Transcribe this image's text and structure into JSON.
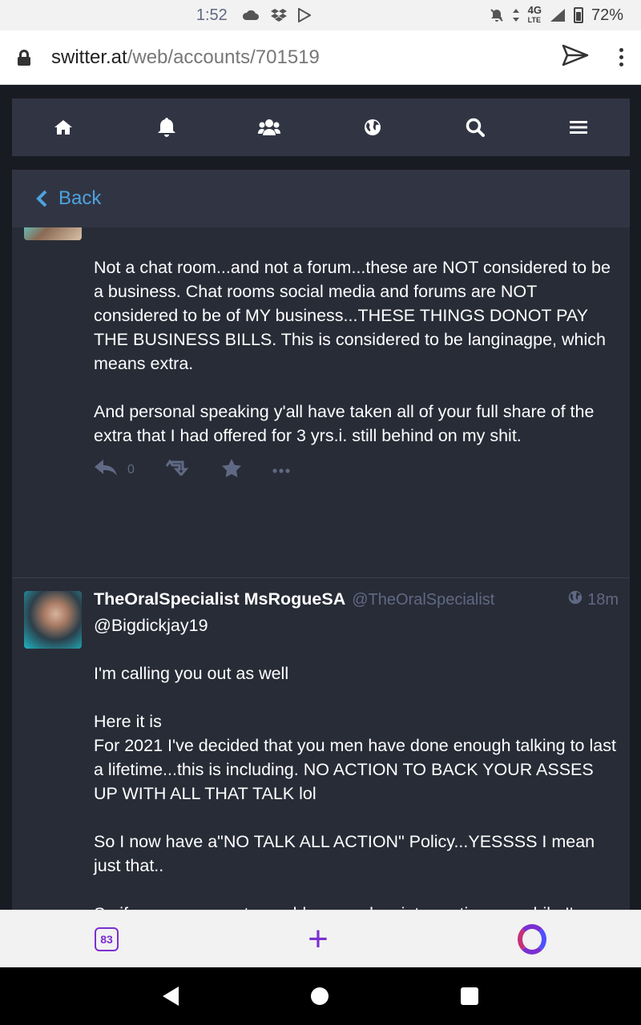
{
  "status_bar": {
    "time": "1:52",
    "network": "4G",
    "network_sub": "LTE",
    "battery": "72%"
  },
  "url_bar": {
    "domain": "switter.at",
    "path": "/web/accounts/701519"
  },
  "nav": {
    "icons": [
      "home-icon",
      "bell-icon",
      "users-icon",
      "globe-icon",
      "search-icon",
      "menu-icon"
    ]
  },
  "column": {
    "back_label": "Back"
  },
  "statuses": [
    {
      "paragraphs": [
        "Not a chat room...and not a forum...these are NOT considered to be a business. Chat rooms social media and forums are NOT considered to be of MY business...THESE THINGS DONOT PAY THE BUSINESS BILLS. This is considered to be langinagpe, which means extra.",
        "And personal speaking y'all have taken all of your full share of the extra that I had offered for 3 yrs.i. still behind on my shit."
      ],
      "reply_count": "0"
    },
    {
      "display_name": "TheOralSpecialist MsRogueSA",
      "acct": "@TheOralSpecialist",
      "time": "18m",
      "paragraphs": [
        "@Bigdickjay19",
        "I'm calling you out as well",
        "Here it is\nFor 2021 I've decided that you men have done enough talking to last a lifetime...this is including. NO ACTION TO BACK YOUR ASSES UP WITH ALL THAT TALK lol",
        "So I now have a\"NO TALK ALL ACTION\" Policy...YESSSS I mean just that..",
        "So if money was not a problem...and yo interrupting me while I'm moving was a problem....I Mean a respectable $20 gesture would have went avery long ways with showing me something. I don't disrupt ur life!!!!"
      ]
    }
  ],
  "browser_bottom": {
    "tab_count": "83"
  }
}
